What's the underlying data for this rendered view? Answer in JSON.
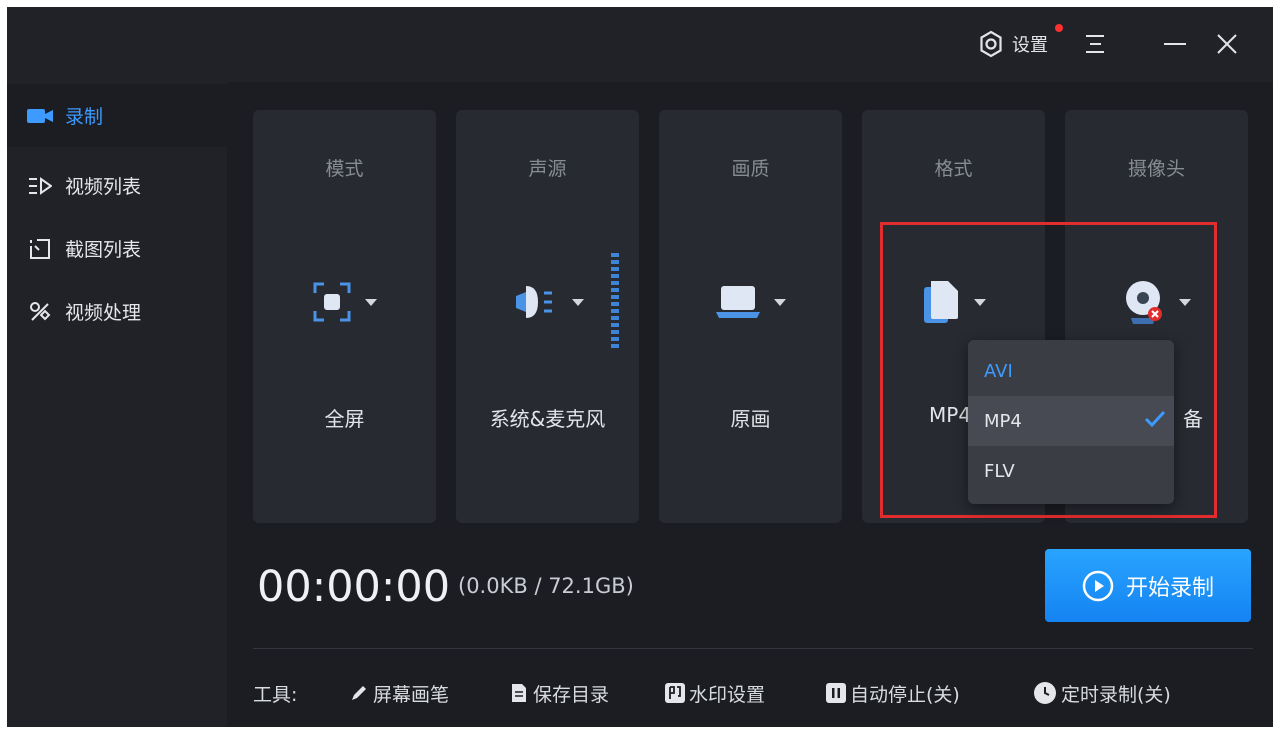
{
  "titlebar": {
    "settings_label": "设置",
    "settings_icon": "settings-icon",
    "menu_icon": "menu-icon",
    "minimize_icon": "minimize-icon",
    "close_icon": "close-icon"
  },
  "sidebar": {
    "items": [
      {
        "label": "录制",
        "icon": "camera-icon",
        "active": true
      },
      {
        "label": "视频列表",
        "icon": "video-list-icon",
        "active": false
      },
      {
        "label": "截图列表",
        "icon": "screenshot-list-icon",
        "active": false
      },
      {
        "label": "视频处理",
        "icon": "video-process-icon",
        "active": false
      }
    ]
  },
  "cards": [
    {
      "title": "模式",
      "value": "全屏",
      "icon": "fullscreen-icon"
    },
    {
      "title": "声源",
      "value": "系统&麦克风",
      "icon": "speaker-icon"
    },
    {
      "title": "画质",
      "value": "原画",
      "icon": "laptop-icon"
    },
    {
      "title": "格式",
      "value": "MP4",
      "icon": "file-icon"
    },
    {
      "title": "摄像头",
      "value": "备",
      "icon": "webcam-icon"
    }
  ],
  "format_dropdown": {
    "options": [
      "AVI",
      "MP4",
      "FLV"
    ],
    "selected": "MP4"
  },
  "recording": {
    "timer": "00:00:00",
    "size": "(0.0KB / 72.1GB)",
    "start_label": "开始录制"
  },
  "tools": {
    "label": "工具:",
    "items": [
      {
        "label": "屏幕画笔",
        "icon": "pen-icon"
      },
      {
        "label": "保存目录",
        "icon": "folder-icon"
      },
      {
        "label": "水印设置",
        "icon": "watermark-icon"
      },
      {
        "label": "自动停止(关)",
        "icon": "pause-icon"
      },
      {
        "label": "定时录制(关)",
        "icon": "clock-icon"
      }
    ]
  },
  "colors": {
    "accent": "#3d9bff",
    "highlight": "#e12d2d",
    "background": "#1b1d22"
  }
}
